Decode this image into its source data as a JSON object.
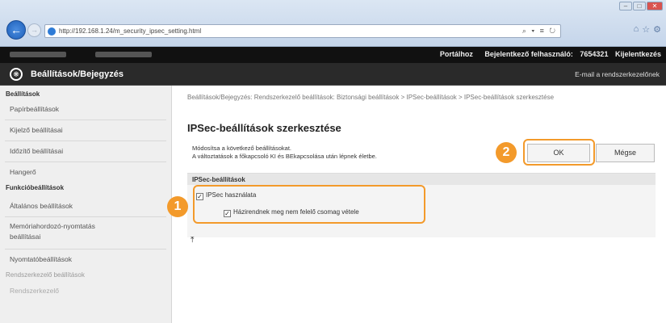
{
  "browser": {
    "url": "http://192.168.1.24/m_security_ipsec_setting.html",
    "toolbar_glyphs": "⌕ ▾ ≡ ↻",
    "right_icons": [
      "⌂",
      "☆",
      "⚙"
    ],
    "window_buttons": [
      "–",
      "□",
      "✕"
    ]
  },
  "topbar": {
    "portal_link": "Portálhoz",
    "user_label": "Bejelentkező felhasználó:",
    "user_id": "7654321",
    "logout": "Kijelentkezés"
  },
  "header": {
    "title": "Beállítások/Bejegyzés",
    "email_link": "E-mail a rendszerkezelőnek"
  },
  "sidebar": {
    "section1": "Beállítások",
    "items1": [
      "Papírbeállítások",
      "Kijelző beállításai",
      "Időzítő beállításai",
      "Hangerő"
    ],
    "section2": "Funkcióbeállítások",
    "items2": [
      "Általános beállítások",
      "Memóriahordozó-nyomtatás beállításai",
      "Nyomtatóbeállítások"
    ],
    "section3": "Rendszerkezelő beállítások",
    "items3": [
      "Rendszerkezelő"
    ]
  },
  "main": {
    "breadcrumb": "Beállítások/Bejegyzés: Rendszerkezelő beállítások: Biztonsági beállítások > IPSec-beállítások > IPSec-beállítások szerkesztése",
    "page_title": "IPSec-beállítások szerkesztése",
    "description_line1": "Módosítsa a következő beállításokat.",
    "description_line2": "A változtatások a főkapcsoló KI és BEkapcsolása után lépnek életbe.",
    "ok_label": "OK",
    "cancel_label": "Mégse",
    "section_title": "IPSec-beállítások",
    "use_ipsec_label": "IPSec használata",
    "use_ipsec_checked": true,
    "non_policy_label": "Házirendnek meg nem felelő csomag vétele",
    "non_policy_checked": true,
    "anchor_glyph": "⤒"
  },
  "callouts": {
    "badge1": "1",
    "badge2": "2",
    "accent_color": "#f39a2b"
  }
}
